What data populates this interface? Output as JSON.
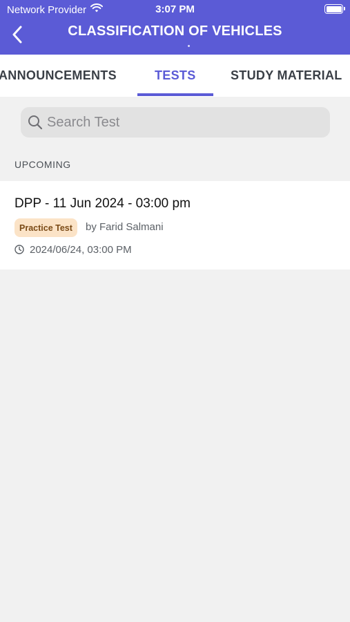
{
  "status_bar": {
    "carrier": "Network Provider",
    "time": "3:07 PM",
    "wifi_icon": "wifi-icon",
    "battery_icon": "battery-icon"
  },
  "header": {
    "title": "CLASSIFICATION OF VEHICLES",
    "back_icon": "chevron-left-icon",
    "background_color": "#5b5bd6"
  },
  "tabs": [
    {
      "label": "ANNOUNCEMENTS",
      "active": false
    },
    {
      "label": "TESTS",
      "active": true
    },
    {
      "label": "STUDY MATERIAL",
      "active": false
    }
  ],
  "search": {
    "placeholder": "Search Test",
    "value": "",
    "icon": "search-icon"
  },
  "section": {
    "label": "UPCOMING"
  },
  "tests": [
    {
      "title": "DPP - 11 Jun 2024 - 03:00 pm",
      "badge": "Practice Test",
      "author": "by Farid Salmani",
      "datetime": "2024/06/24, 03:00 PM",
      "datetime_icon": "clock-icon"
    }
  ],
  "colors": {
    "accent": "#5b5bd6",
    "badge_bg": "#fbe3c7",
    "badge_text": "#7a4a16",
    "page_bg": "#f1f1f1"
  }
}
